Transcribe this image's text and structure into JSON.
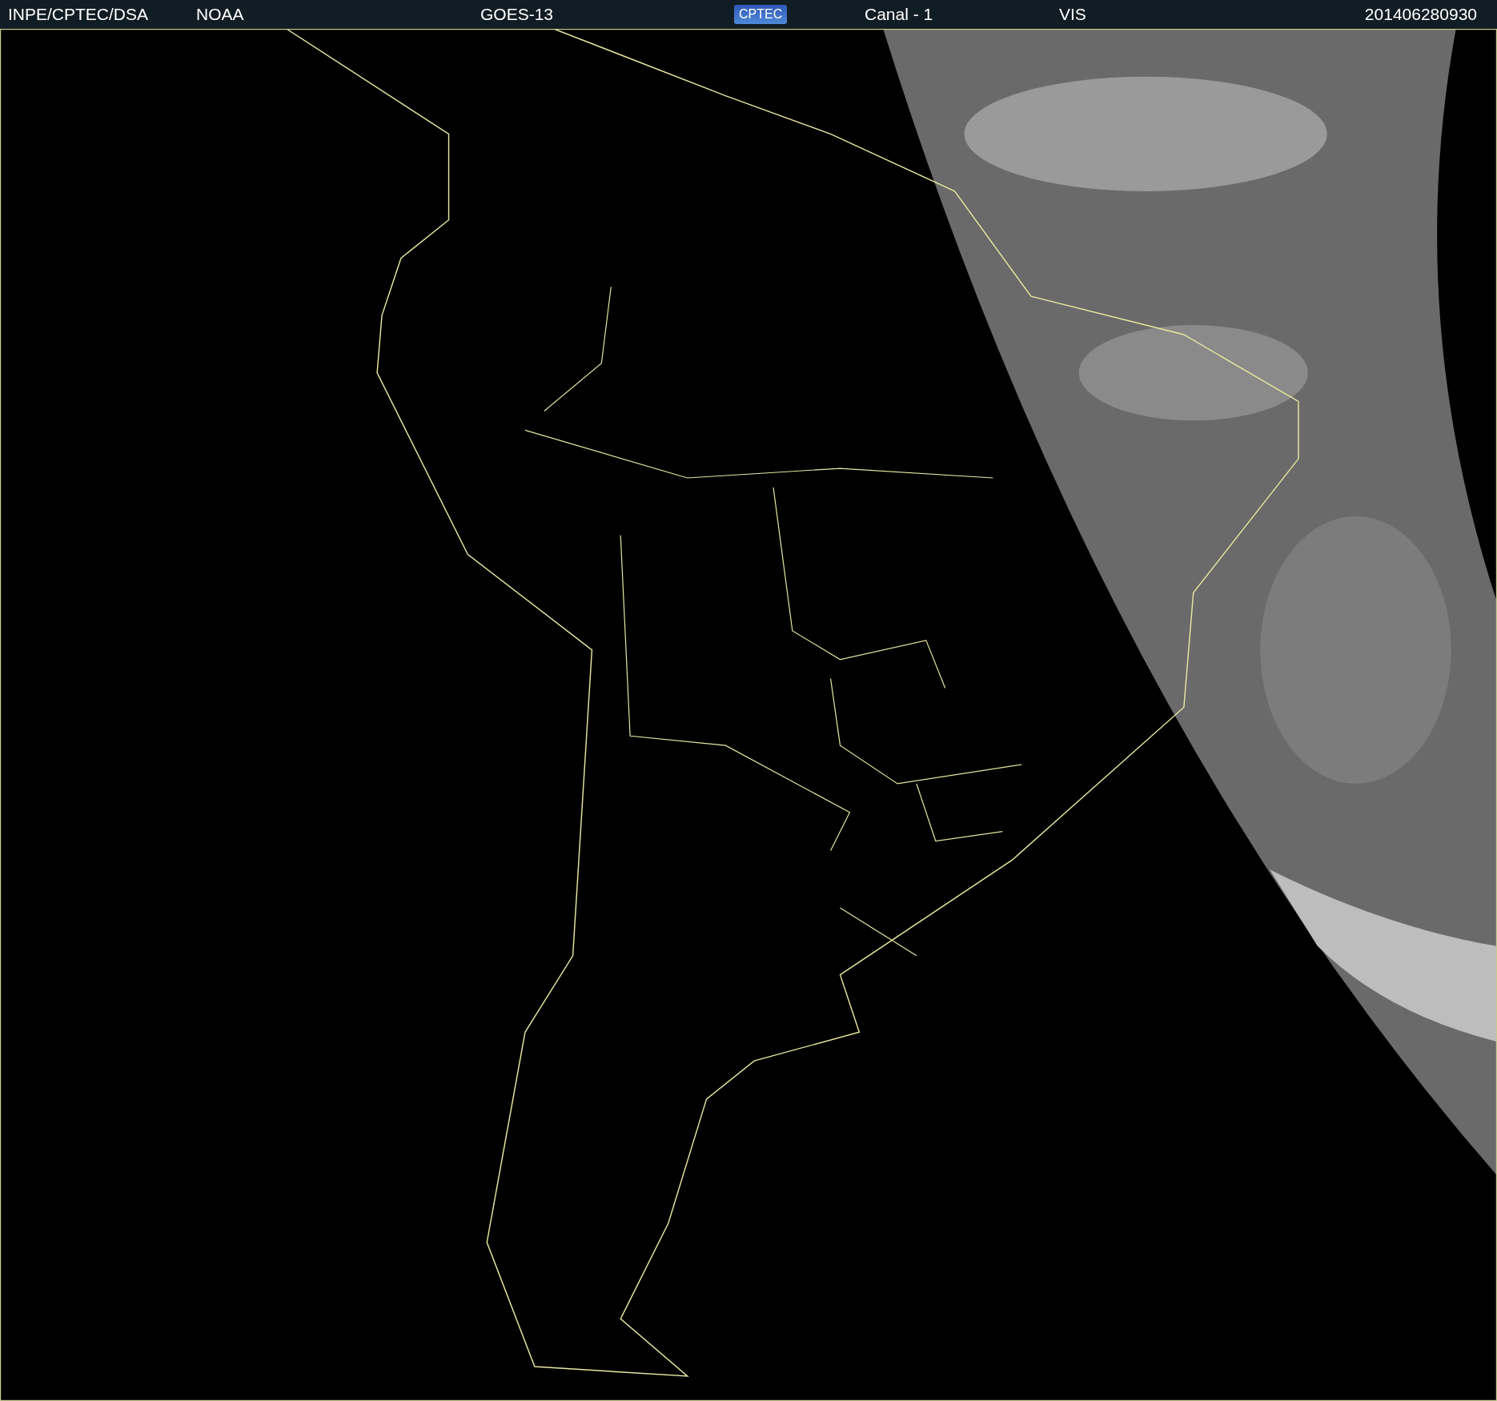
{
  "header": {
    "source": "INPE/CPTEC/DSA",
    "agency": "NOAA",
    "satellite": "GOES-13",
    "logo": "CPTEC",
    "channel": "Canal - 1",
    "band": "VIS",
    "timestamp": "201406280930"
  }
}
